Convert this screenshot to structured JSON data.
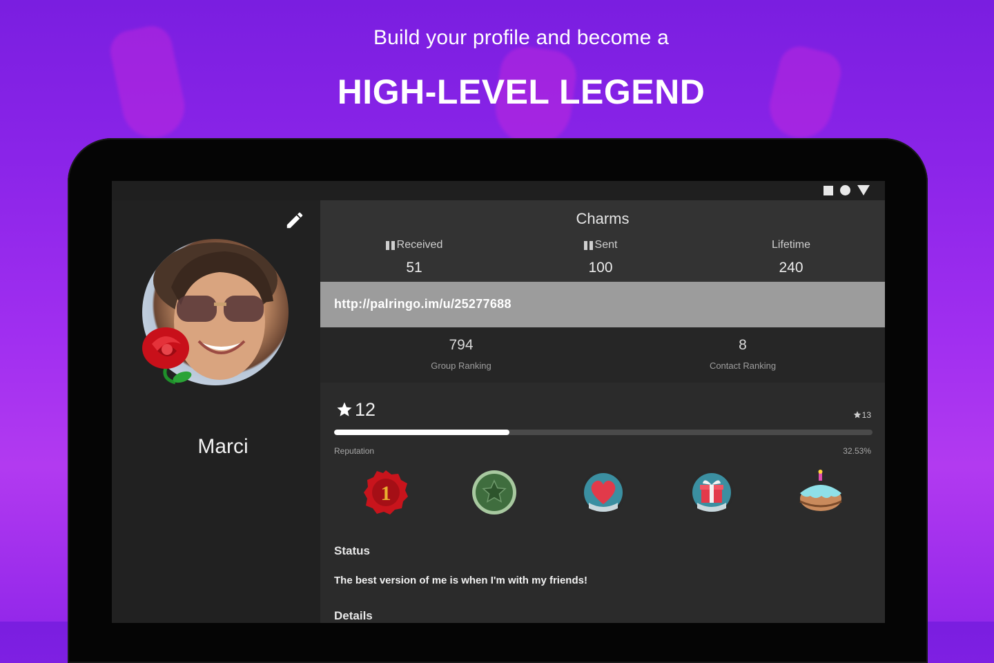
{
  "promo": {
    "subtitle": "Build your profile and become a",
    "title": "HIGH-LEVEL LEGEND"
  },
  "profile": {
    "name": "Marci",
    "edit_icon": "pencil-icon",
    "badge_icon": "rose-icon"
  },
  "charms": {
    "title": "Charms",
    "received_label": "Received",
    "received_value": "51",
    "sent_label": "Sent",
    "sent_value": "100",
    "lifetime_label": "Lifetime",
    "lifetime_value": "240"
  },
  "profile_url": "http://palringo.im/u/25277688",
  "rankings": {
    "group_value": "794",
    "group_label": "Group Ranking",
    "contact_value": "8",
    "contact_label": "Contact Ranking"
  },
  "reputation": {
    "level": "12",
    "next_level": "13",
    "label": "Reputation",
    "percent_text": "32.53%",
    "progress_fraction": 0.3253
  },
  "achievements": [
    {
      "name": "wax-seal-one-badge"
    },
    {
      "name": "green-star-badge"
    },
    {
      "name": "heart-badge"
    },
    {
      "name": "gift-badge"
    },
    {
      "name": "cupcake-badge"
    }
  ],
  "status": {
    "heading": "Status",
    "text": "The best version of me is when I'm with my friends!"
  },
  "details": {
    "heading": "Details"
  },
  "colors": {
    "background_top": "#7a1ee0",
    "background_bottom": "#b23af0",
    "panel_dark": "#212121",
    "url_bar": "#9c9c9c"
  }
}
